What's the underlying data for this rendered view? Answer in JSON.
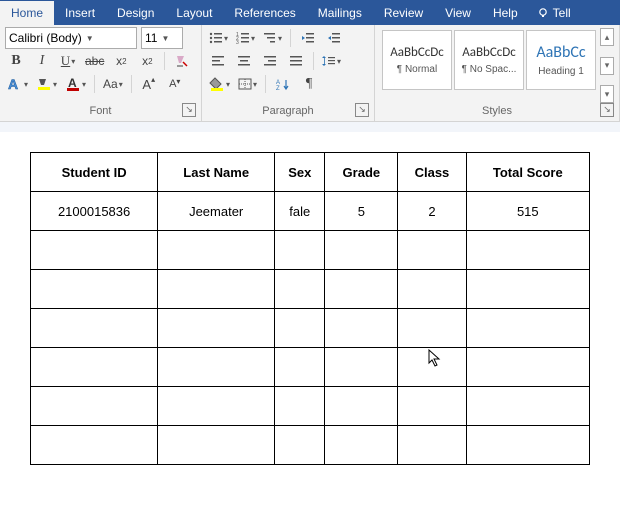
{
  "tabs": {
    "home": "Home",
    "insert": "Insert",
    "design": "Design",
    "layout": "Layout",
    "references": "References",
    "mailings": "Mailings",
    "review": "Review",
    "view": "View",
    "help": "Help",
    "tell": "Tell"
  },
  "ribbon": {
    "font": {
      "name": "Calibri (Body)",
      "size": "11",
      "title": "Font"
    },
    "paragraph": {
      "title": "Paragraph"
    },
    "styles": {
      "title": "Styles",
      "items": [
        {
          "preview": "AaBbCcDc",
          "name": "¶ Normal",
          "size": "13px",
          "color": "#333"
        },
        {
          "preview": "AaBbCcDc",
          "name": "¶ No Spac...",
          "size": "13px",
          "color": "#333"
        },
        {
          "preview": "AaBbCc",
          "name": "Heading 1",
          "size": "16px",
          "color": "#2e74b5"
        }
      ]
    }
  },
  "table": {
    "headers": [
      "Student ID",
      "Last Name",
      "Sex",
      "Grade",
      "Class",
      "Total Score"
    ],
    "rows": [
      [
        "2100015836",
        "Jeemater",
        "fale",
        "5",
        "2",
        "515"
      ],
      [
        "",
        "",
        "",
        "",
        "",
        ""
      ],
      [
        "",
        "",
        "",
        "",
        "",
        ""
      ],
      [
        "",
        "",
        "",
        "",
        "",
        ""
      ],
      [
        "",
        "",
        "",
        "",
        "",
        ""
      ],
      [
        "",
        "",
        "",
        "",
        "",
        ""
      ],
      [
        "",
        "",
        "",
        "",
        "",
        ""
      ]
    ]
  }
}
